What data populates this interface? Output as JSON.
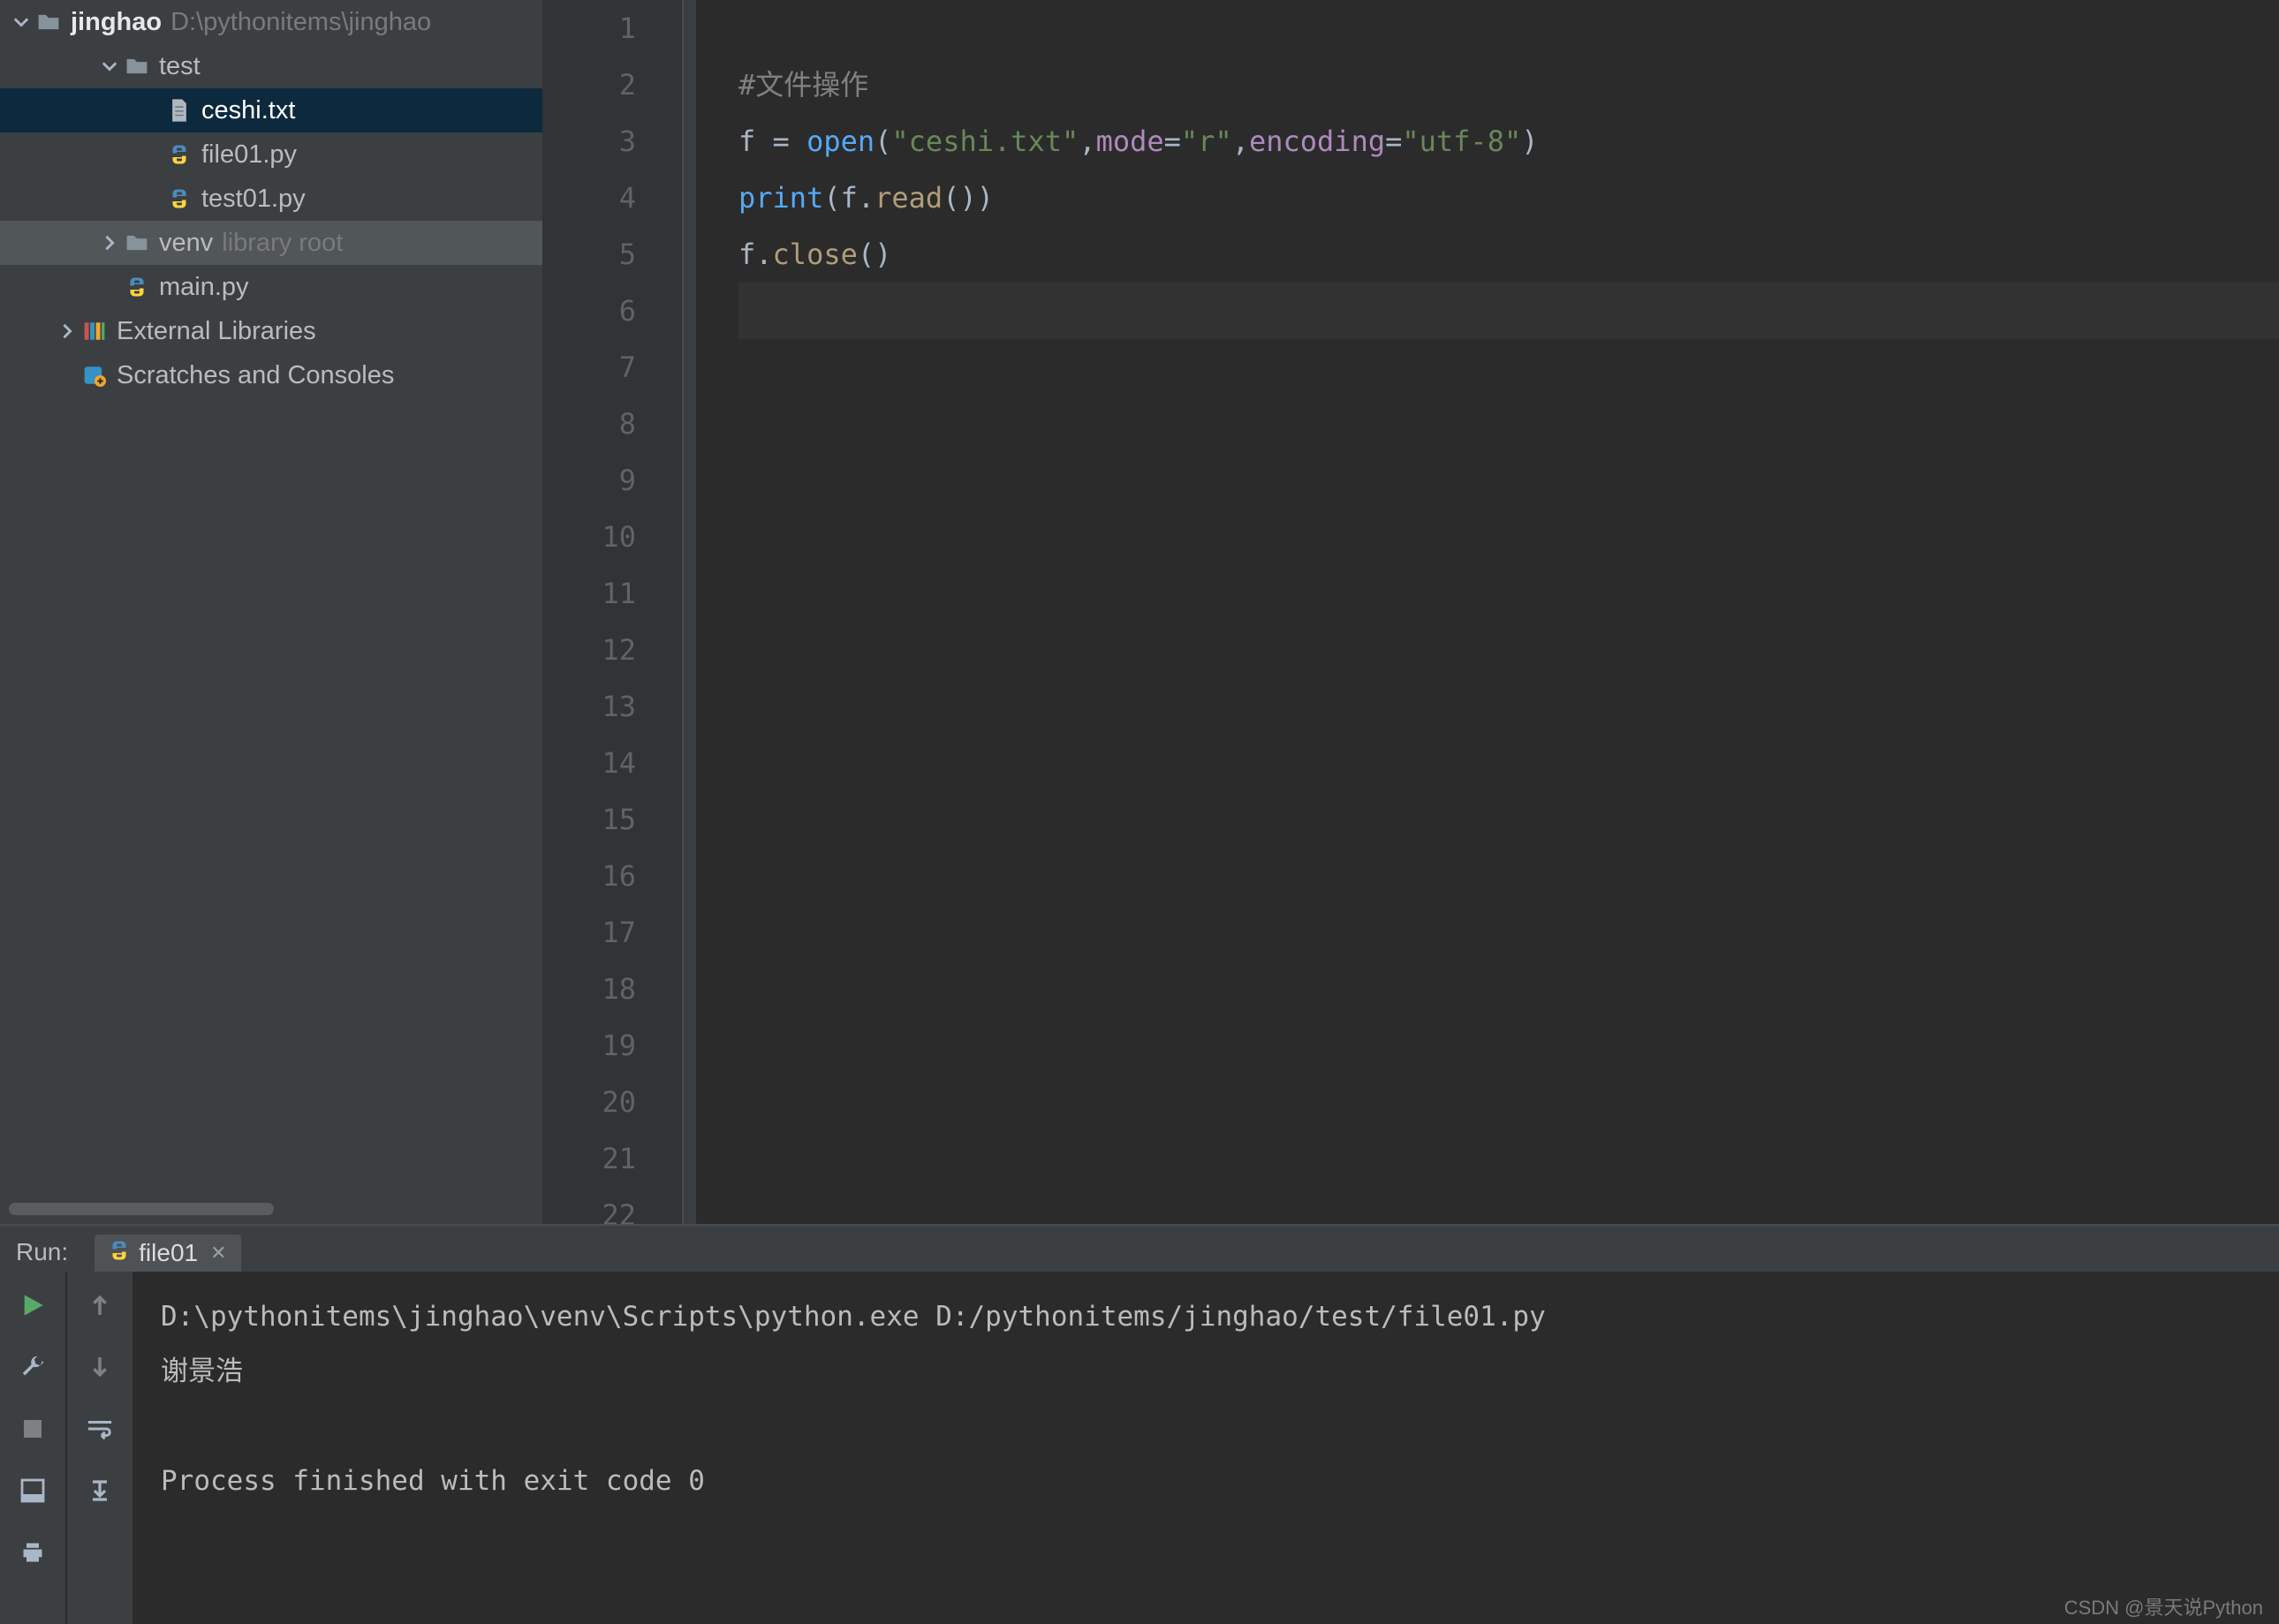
{
  "project_tree": {
    "root": {
      "name": "jinghao",
      "hint": "D:\\pythonitems\\jinghao"
    },
    "items": [
      {
        "indent": 1,
        "chevron": "down",
        "icon": "folder",
        "label": "test",
        "bold": false,
        "selected": false,
        "highlight": false
      },
      {
        "indent": 2,
        "chevron": "",
        "icon": "txt",
        "label": "ceshi.txt",
        "bold": false,
        "selected": true,
        "highlight": false
      },
      {
        "indent": 2,
        "chevron": "",
        "icon": "py",
        "label": "file01.py",
        "bold": false,
        "selected": false,
        "highlight": false
      },
      {
        "indent": 2,
        "chevron": "",
        "icon": "py",
        "label": "test01.py",
        "bold": false,
        "selected": false,
        "highlight": false
      },
      {
        "indent": 1,
        "chevron": "right",
        "icon": "folder",
        "label": "venv",
        "hint": "library root",
        "bold": false,
        "selected": false,
        "highlight": true
      },
      {
        "indent": 1,
        "chevron": "",
        "icon": "py",
        "label": "main.py",
        "bold": false,
        "selected": false,
        "highlight": false
      },
      {
        "indent": 0,
        "chevron": "right",
        "icon": "lib",
        "label": "External Libraries",
        "bold": false,
        "selected": false,
        "highlight": false
      },
      {
        "indent": 0,
        "chevron": "",
        "icon": "scratch",
        "label": "Scratches and Consoles",
        "bold": false,
        "selected": false,
        "highlight": false
      }
    ]
  },
  "editor": {
    "line_numbers": [
      "1",
      "2",
      "3",
      "4",
      "5",
      "6",
      "7",
      "8",
      "9",
      "10",
      "11",
      "12",
      "13",
      "14",
      "15",
      "16",
      "17",
      "18",
      "19",
      "20",
      "21",
      "22"
    ],
    "current_line_index": 5,
    "lines": [
      {
        "tokens": []
      },
      {
        "tokens": [
          {
            "t": "#文件操作",
            "c": "tok-comment"
          }
        ]
      },
      {
        "tokens": [
          {
            "t": "f ",
            "c": "tok-default"
          },
          {
            "t": "=",
            "c": "tok-default"
          },
          {
            "t": " ",
            "c": "tok-default"
          },
          {
            "t": "open",
            "c": "tok-call"
          },
          {
            "t": "(",
            "c": "tok-default"
          },
          {
            "t": "\"ceshi.txt\"",
            "c": "tok-string"
          },
          {
            "t": ",",
            "c": "tok-default"
          },
          {
            "t": "mode",
            "c": "tok-kwarg"
          },
          {
            "t": "=",
            "c": "tok-default"
          },
          {
            "t": "\"r\"",
            "c": "tok-string"
          },
          {
            "t": ",",
            "c": "tok-default"
          },
          {
            "t": "encoding",
            "c": "tok-kwarg"
          },
          {
            "t": "=",
            "c": "tok-default"
          },
          {
            "t": "\"utf-8\"",
            "c": "tok-string"
          },
          {
            "t": ")",
            "c": "tok-default"
          }
        ]
      },
      {
        "tokens": [
          {
            "t": "print",
            "c": "tok-call"
          },
          {
            "t": "(f.",
            "c": "tok-default"
          },
          {
            "t": "read",
            "c": "tok-method"
          },
          {
            "t": "())",
            "c": "tok-default"
          }
        ]
      },
      {
        "tokens": [
          {
            "t": "f.",
            "c": "tok-default"
          },
          {
            "t": "close",
            "c": "tok-method"
          },
          {
            "t": "()",
            "c": "tok-default"
          }
        ]
      },
      {
        "tokens": []
      },
      {
        "tokens": []
      },
      {
        "tokens": []
      },
      {
        "tokens": []
      },
      {
        "tokens": []
      },
      {
        "tokens": []
      },
      {
        "tokens": []
      },
      {
        "tokens": []
      },
      {
        "tokens": []
      },
      {
        "tokens": []
      },
      {
        "tokens": []
      },
      {
        "tokens": []
      },
      {
        "tokens": []
      },
      {
        "tokens": []
      },
      {
        "tokens": []
      },
      {
        "tokens": []
      },
      {
        "tokens": []
      }
    ]
  },
  "run_panel": {
    "label": "Run:",
    "tab": {
      "name": "file01"
    },
    "output": [
      "D:\\pythonitems\\jinghao\\venv\\Scripts\\python.exe D:/pythonitems/jinghao/test/file01.py",
      "谢景浩",
      "",
      "Process finished with exit code 0"
    ]
  },
  "watermark": "CSDN @景天说Python"
}
